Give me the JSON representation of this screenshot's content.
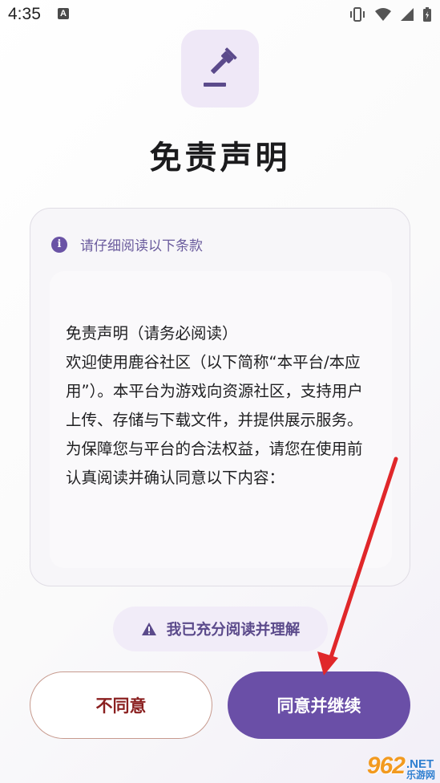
{
  "status_bar": {
    "time": "4:35",
    "notification_icon": "A"
  },
  "header": {
    "icon": "gavel-icon",
    "title": "免责声明"
  },
  "card": {
    "header_text": "请仔细阅读以下条款",
    "body_text": "免责声明（请务必阅读）\n欢迎使用鹿谷社区（以下简称“本平台/本应用”）。本平台为游戏向资源社区，支持用户上传、存储与下载文件，并提供展示服务。为保障您与平台的合法权益，请您在使用前认真阅读并确认同意以下内容："
  },
  "ack": {
    "label": "我已充分阅读并理解"
  },
  "buttons": {
    "decline": "不同意",
    "agree": "同意并继续"
  },
  "watermark": {
    "number": "962",
    "net": ".NET",
    "cn": "乐游网"
  },
  "colors": {
    "accent": "#6a4fa7",
    "decline_text": "#8a1f1f",
    "arrow": "#e0272a"
  }
}
